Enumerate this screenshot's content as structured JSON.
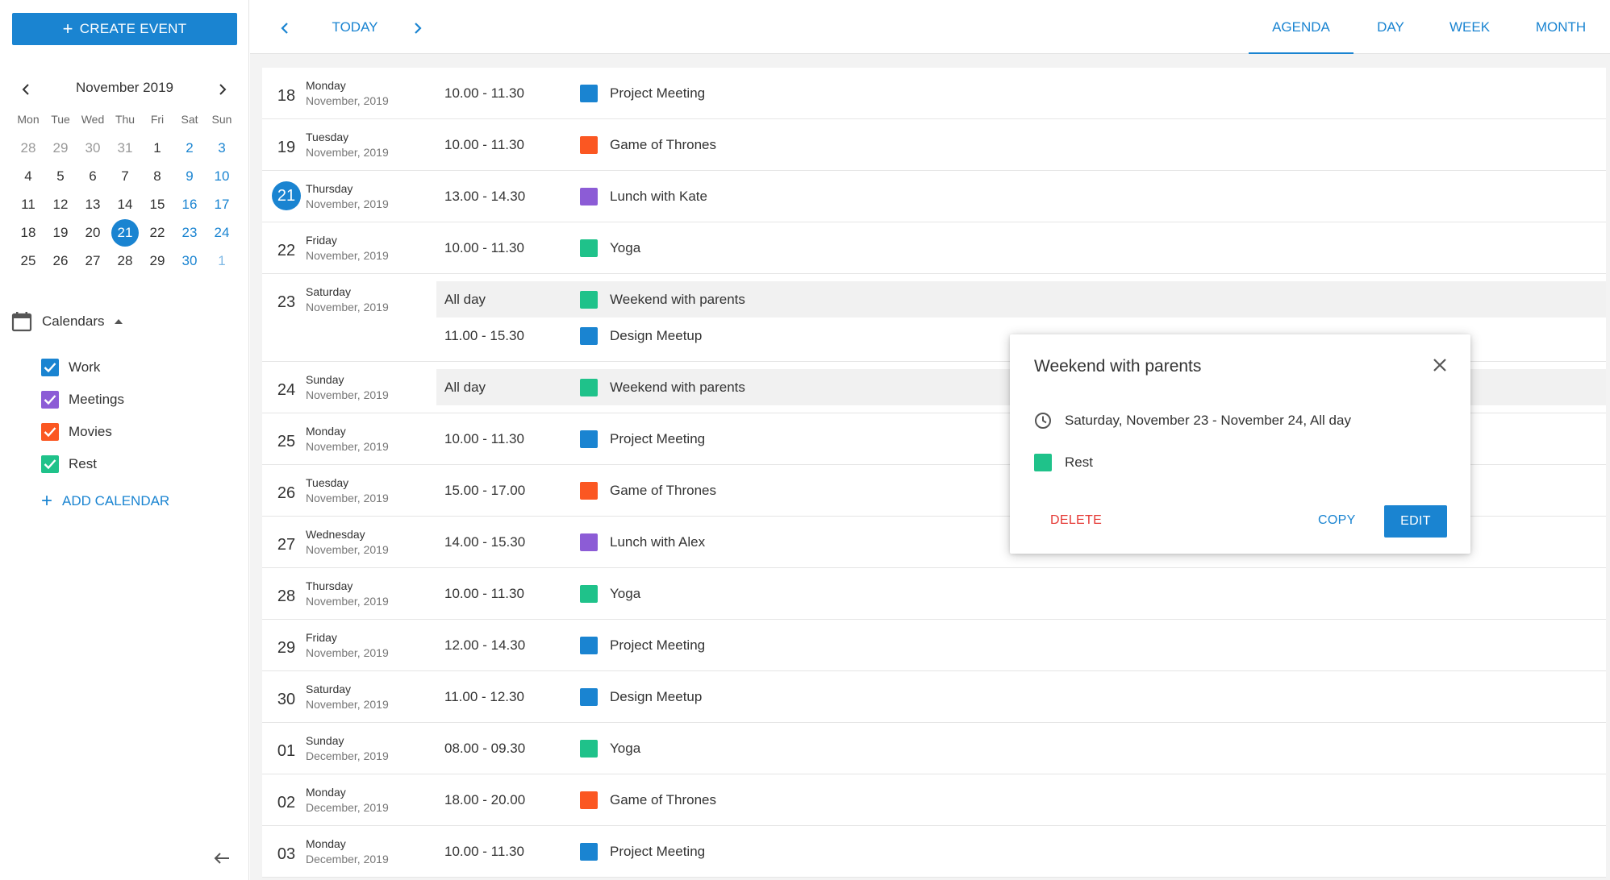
{
  "sidebar": {
    "create_event_label": "CREATE EVENT",
    "mini_calendar": {
      "month_label": "November 2019",
      "weekdays": [
        "Mon",
        "Tue",
        "Wed",
        "Thu",
        "Fri",
        "Sat",
        "Sun"
      ],
      "weeks": [
        [
          {
            "d": "28",
            "muted": true
          },
          {
            "d": "29",
            "muted": true
          },
          {
            "d": "30",
            "muted": true
          },
          {
            "d": "31",
            "muted": true
          },
          {
            "d": "1"
          },
          {
            "d": "2",
            "weekend": true
          },
          {
            "d": "3",
            "weekend": true
          }
        ],
        [
          {
            "d": "4"
          },
          {
            "d": "5"
          },
          {
            "d": "6"
          },
          {
            "d": "7"
          },
          {
            "d": "8"
          },
          {
            "d": "9",
            "weekend": true
          },
          {
            "d": "10",
            "weekend": true
          }
        ],
        [
          {
            "d": "11"
          },
          {
            "d": "12"
          },
          {
            "d": "13"
          },
          {
            "d": "14"
          },
          {
            "d": "15"
          },
          {
            "d": "16",
            "weekend": true
          },
          {
            "d": "17",
            "weekend": true
          }
        ],
        [
          {
            "d": "18"
          },
          {
            "d": "19"
          },
          {
            "d": "20"
          },
          {
            "d": "21",
            "selected": true
          },
          {
            "d": "22"
          },
          {
            "d": "23",
            "weekend": true
          },
          {
            "d": "24",
            "weekend": true
          }
        ],
        [
          {
            "d": "25"
          },
          {
            "d": "26"
          },
          {
            "d": "27"
          },
          {
            "d": "28"
          },
          {
            "d": "29"
          },
          {
            "d": "30",
            "weekend": true
          },
          {
            "d": "1",
            "weekend": true,
            "muted": true
          }
        ]
      ]
    },
    "calendars_title": "Calendars",
    "calendars": [
      {
        "label": "Work",
        "color": "#1a84d1",
        "checked": true
      },
      {
        "label": "Meetings",
        "color": "#8c5cd6",
        "checked": true
      },
      {
        "label": "Movies",
        "color": "#fb5722",
        "checked": true
      },
      {
        "label": "Rest",
        "color": "#1fc28a",
        "checked": true
      }
    ],
    "add_calendar_label": "ADD CALENDAR"
  },
  "topbar": {
    "today_label": "TODAY",
    "tabs": [
      {
        "label": "AGENDA",
        "active": true
      },
      {
        "label": "DAY",
        "active": false
      },
      {
        "label": "WEEK",
        "active": false
      },
      {
        "label": "MONTH",
        "active": false
      }
    ]
  },
  "colors": {
    "accent": "#1a84d1",
    "work": "#1a84d1",
    "meetings": "#8c5cd6",
    "movies": "#fb5722",
    "rest": "#1fc28a",
    "delete": "#e53935"
  },
  "agenda": [
    {
      "day": "18",
      "weekday": "Monday",
      "month": "November, 2019",
      "events": [
        {
          "time": "10.00 - 11.30",
          "title": "Project Meeting",
          "color": "#1a84d1"
        }
      ]
    },
    {
      "day": "19",
      "weekday": "Tuesday",
      "month": "November, 2019",
      "events": [
        {
          "time": "10.00 - 11.30",
          "title": "Game of Thrones",
          "color": "#fb5722"
        }
      ]
    },
    {
      "day": "21",
      "weekday": "Thursday",
      "month": "November, 2019",
      "today": true,
      "events": [
        {
          "time": "13.00 - 14.30",
          "title": "Lunch with Kate",
          "color": "#8c5cd6"
        }
      ]
    },
    {
      "day": "22",
      "weekday": "Friday",
      "month": "November, 2019",
      "events": [
        {
          "time": "10.00 - 11.30",
          "title": "Yoga",
          "color": "#1fc28a"
        }
      ]
    },
    {
      "day": "23",
      "weekday": "Saturday",
      "month": "November, 2019",
      "events": [
        {
          "time": "All day",
          "title": "Weekend with parents",
          "color": "#1fc28a",
          "allday": true
        },
        {
          "time": "11.00 - 15.30",
          "title": "Design Meetup",
          "color": "#1a84d1"
        }
      ]
    },
    {
      "day": "24",
      "weekday": "Sunday",
      "month": "November, 2019",
      "events": [
        {
          "time": "All day",
          "title": "Weekend with parents",
          "color": "#1fc28a",
          "allday": true
        }
      ]
    },
    {
      "day": "25",
      "weekday": "Monday",
      "month": "November, 2019",
      "events": [
        {
          "time": "10.00 - 11.30",
          "title": "Project Meeting",
          "color": "#1a84d1"
        }
      ]
    },
    {
      "day": "26",
      "weekday": "Tuesday",
      "month": "November, 2019",
      "events": [
        {
          "time": "15.00 - 17.00",
          "title": "Game of Thrones",
          "color": "#fb5722"
        }
      ]
    },
    {
      "day": "27",
      "weekday": "Wednesday",
      "month": "November, 2019",
      "events": [
        {
          "time": "14.00 - 15.30",
          "title": "Lunch with Alex",
          "color": "#8c5cd6"
        }
      ]
    },
    {
      "day": "28",
      "weekday": "Thursday",
      "month": "November, 2019",
      "events": [
        {
          "time": "10.00 - 11.30",
          "title": "Yoga",
          "color": "#1fc28a"
        }
      ]
    },
    {
      "day": "29",
      "weekday": "Friday",
      "month": "November, 2019",
      "events": [
        {
          "time": "12.00 - 14.30",
          "title": "Project Meeting",
          "color": "#1a84d1"
        }
      ]
    },
    {
      "day": "30",
      "weekday": "Saturday",
      "month": "November, 2019",
      "events": [
        {
          "time": "11.00 - 12.30",
          "title": "Design Meetup",
          "color": "#1a84d1"
        }
      ]
    },
    {
      "day": "01",
      "weekday": "Sunday",
      "month": "December, 2019",
      "events": [
        {
          "time": "08.00 - 09.30",
          "title": "Yoga",
          "color": "#1fc28a"
        }
      ]
    },
    {
      "day": "02",
      "weekday": "Monday",
      "month": "December, 2019",
      "events": [
        {
          "time": "18.00 - 20.00",
          "title": "Game of Thrones",
          "color": "#fb5722"
        }
      ]
    },
    {
      "day": "03",
      "weekday": "Monday",
      "month": "December, 2019",
      "events": [
        {
          "time": "10.00 - 11.30",
          "title": "Project Meeting",
          "color": "#1a84d1"
        }
      ]
    }
  ],
  "popup": {
    "title": "Weekend with parents",
    "when": "Saturday, November 23 - November 24, All day",
    "calendar_label": "Rest",
    "calendar_color": "#1fc28a",
    "delete_label": "DELETE",
    "copy_label": "COPY",
    "edit_label": "EDIT"
  },
  "icons": {
    "close": "close-icon",
    "clock": "clock-icon",
    "calendar": "calendar-icon",
    "chevron_left": "chevron-left-icon",
    "chevron_right": "chevron-right-icon",
    "arrow_left": "arrow-left-icon"
  }
}
